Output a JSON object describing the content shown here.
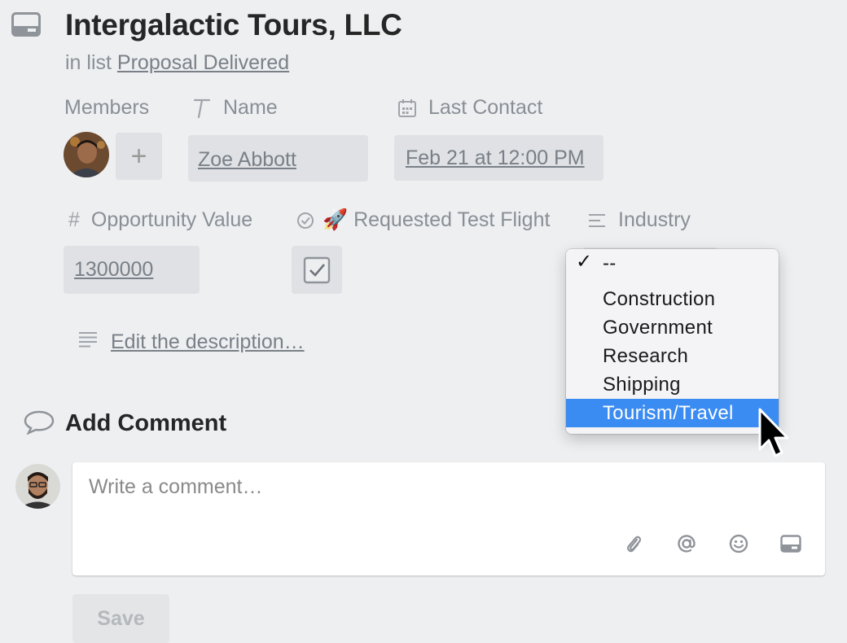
{
  "card": {
    "title": "Intergalactic Tours, LLC",
    "in_list_prefix": "in list",
    "list_name": "Proposal Delivered"
  },
  "fields": {
    "members_label": "Members",
    "add_member": "+",
    "name_label": "Name",
    "name_value": "Zoe Abbott",
    "last_contact_label": "Last Contact",
    "last_contact_value": "Feb 21 at 12:00 PM",
    "opportunity_label": "Opportunity Value",
    "opportunity_value": "1300000",
    "test_flight_label": "🚀 Requested Test Flight",
    "test_flight_checked": true,
    "industry_label": "Industry"
  },
  "description": {
    "link": "Edit the description…"
  },
  "comment": {
    "heading": "Add Comment",
    "placeholder": "Write a comment…",
    "save_label": "Save"
  },
  "industry_menu": {
    "items": [
      {
        "label": "--",
        "checked": true
      },
      {
        "label": "Construction"
      },
      {
        "label": "Government"
      },
      {
        "label": "Research"
      },
      {
        "label": "Shipping"
      },
      {
        "label": "Tourism/Travel",
        "highlighted": true
      }
    ],
    "selected_color": "#3a8bf2"
  }
}
